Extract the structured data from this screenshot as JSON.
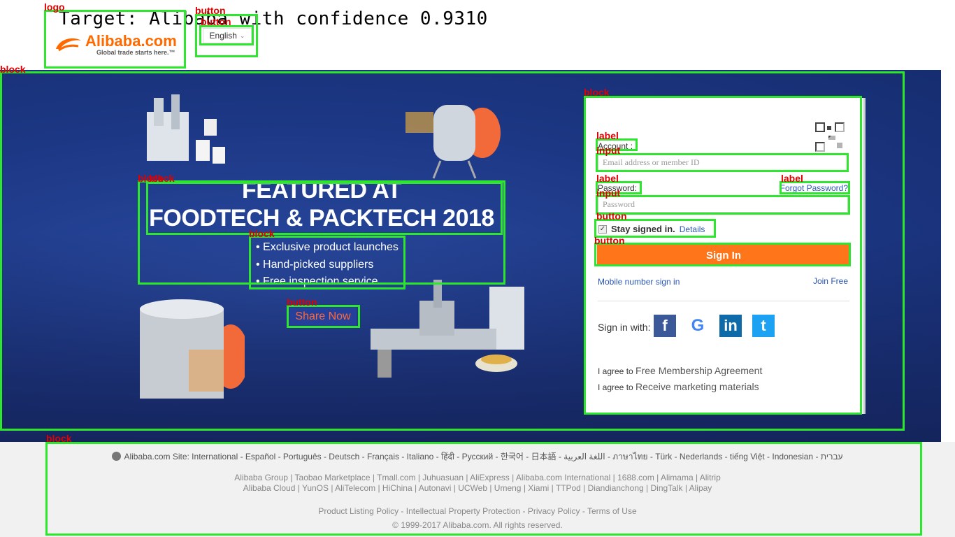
{
  "caption": "Target: Alibaba with confidence 0.9310",
  "header": {
    "logo_word": "Alibaba.com",
    "logo_tag": "Global trade starts here.™",
    "language": "English"
  },
  "hero": {
    "title_line1": "FEATURED AT",
    "title_line2": "FOODTECH & PACKTECH 2018",
    "bullets": [
      "Exclusive product launches",
      "Hand-picked suppliers",
      "Free inspection service"
    ],
    "share_label": "Share Now"
  },
  "login": {
    "account_label": "Account :",
    "account_placeholder": "Email address or member ID",
    "password_label": "Password:",
    "forgot_label": "Forgot Password?",
    "password_placeholder": "Password",
    "stay_label": "Stay signed in.",
    "details_label": "Details",
    "signin_label": "Sign In",
    "mobile_label": "Mobile number sign in",
    "join_label": "Join Free",
    "signin_with_label": "Sign in with:",
    "social": [
      "f",
      "G",
      "in",
      "t"
    ],
    "agree_prefix": "I agree to",
    "agree_1": "Free Membership Agreement",
    "agree_2": "Receive marketing materials"
  },
  "footer": {
    "site_line": "Alibaba.com Site: International - Español - Português - Deutsch - Français - Italiano - हिंदी - Pусский - 한국어 - 日本語 - اللغة العربية - ภาษาไทย - Türk - Nederlands - tiếng Việt - Indonesian - עברית",
    "group_line1": "Alibaba Group | Taobao Marketplace | Tmall.com | Juhuasuan | AliExpress | Alibaba.com International | 1688.com | Alimama | Alitrip",
    "group_line2": "Alibaba Cloud | YunOS | AliTelecom | HiChina | Autonavi | UCWeb | Umeng | Xiami | TTPod | Diandianchong | DingTalk | Alipay",
    "policy_line": "Product Listing Policy - Intellectual Property Protection - Privacy Policy - Terms of Use",
    "copyright": "© 1999-2017 Alibaba.com. All rights reserved."
  },
  "overlay_labels": {
    "logo": "logo",
    "button": "button",
    "block": "block",
    "label": "label",
    "input": "input"
  },
  "colors": {
    "brand_orange": "#ff6a00",
    "hero_blue": "#1b3a8a",
    "link_blue": "#2a57b6",
    "overlay_green": "#2ee62e",
    "overlay_red": "#e00000"
  }
}
